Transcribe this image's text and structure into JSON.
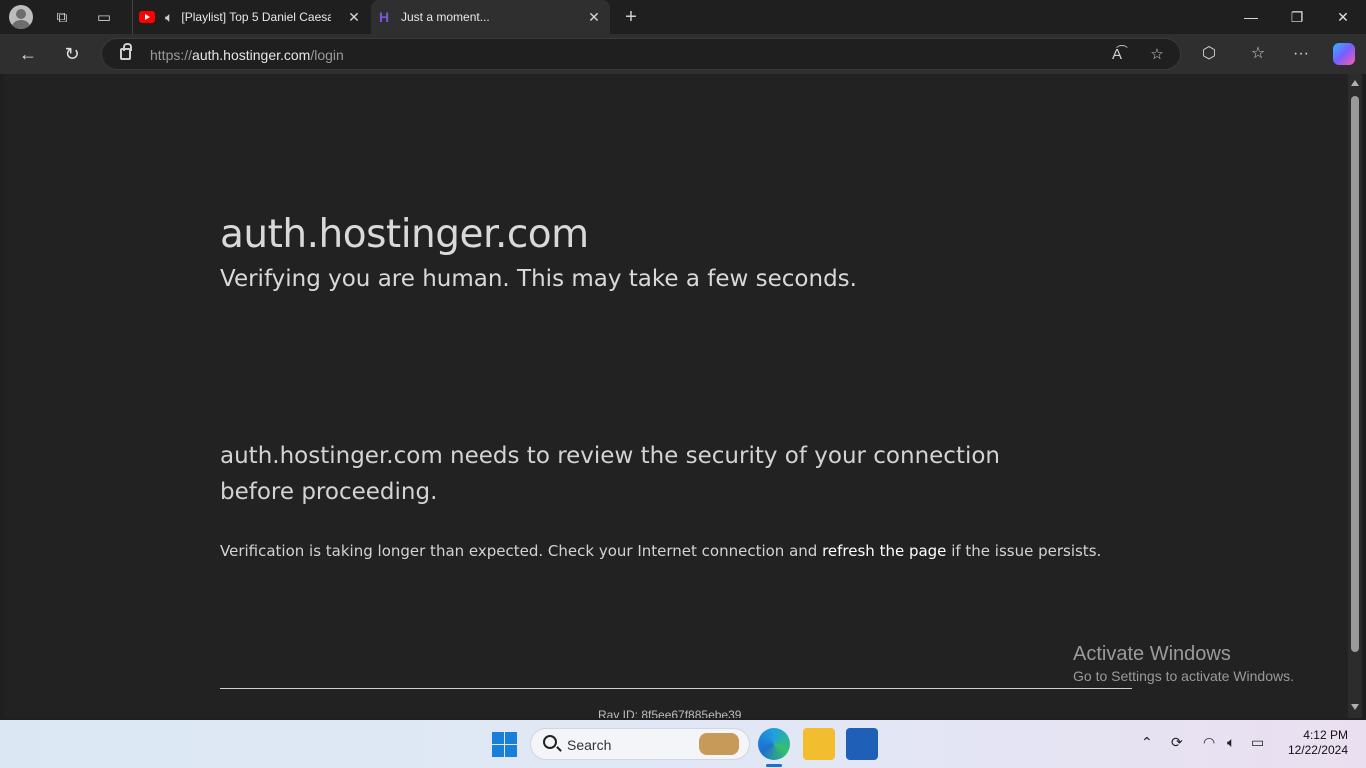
{
  "tabs": [
    {
      "title": "[Playlist] Top 5 Daniel Caesar"
    },
    {
      "title": "Just a moment..."
    }
  ],
  "address_bar": {
    "scheme": "https://",
    "host": "auth.hostinger.com",
    "path": "/login"
  },
  "page": {
    "heading": "auth.hostinger.com",
    "subheading": "Verifying you are human. This may take a few seconds.",
    "description": "auth.hostinger.com needs to review the security of your connection before proceeding.",
    "note_prefix": "Verification is taking longer than expected. Check your Internet connection and ",
    "note_link": "refresh the page",
    "note_suffix": " if the issue persists.",
    "ray_id": "Ray ID: 8f5ee67f885ebe39"
  },
  "watermark": {
    "line1": "Activate Windows",
    "line2": "Go to Settings to activate Windows."
  },
  "taskbar": {
    "search_label": "Search",
    "time": "4:12 PM",
    "date": "12/22/2024"
  }
}
